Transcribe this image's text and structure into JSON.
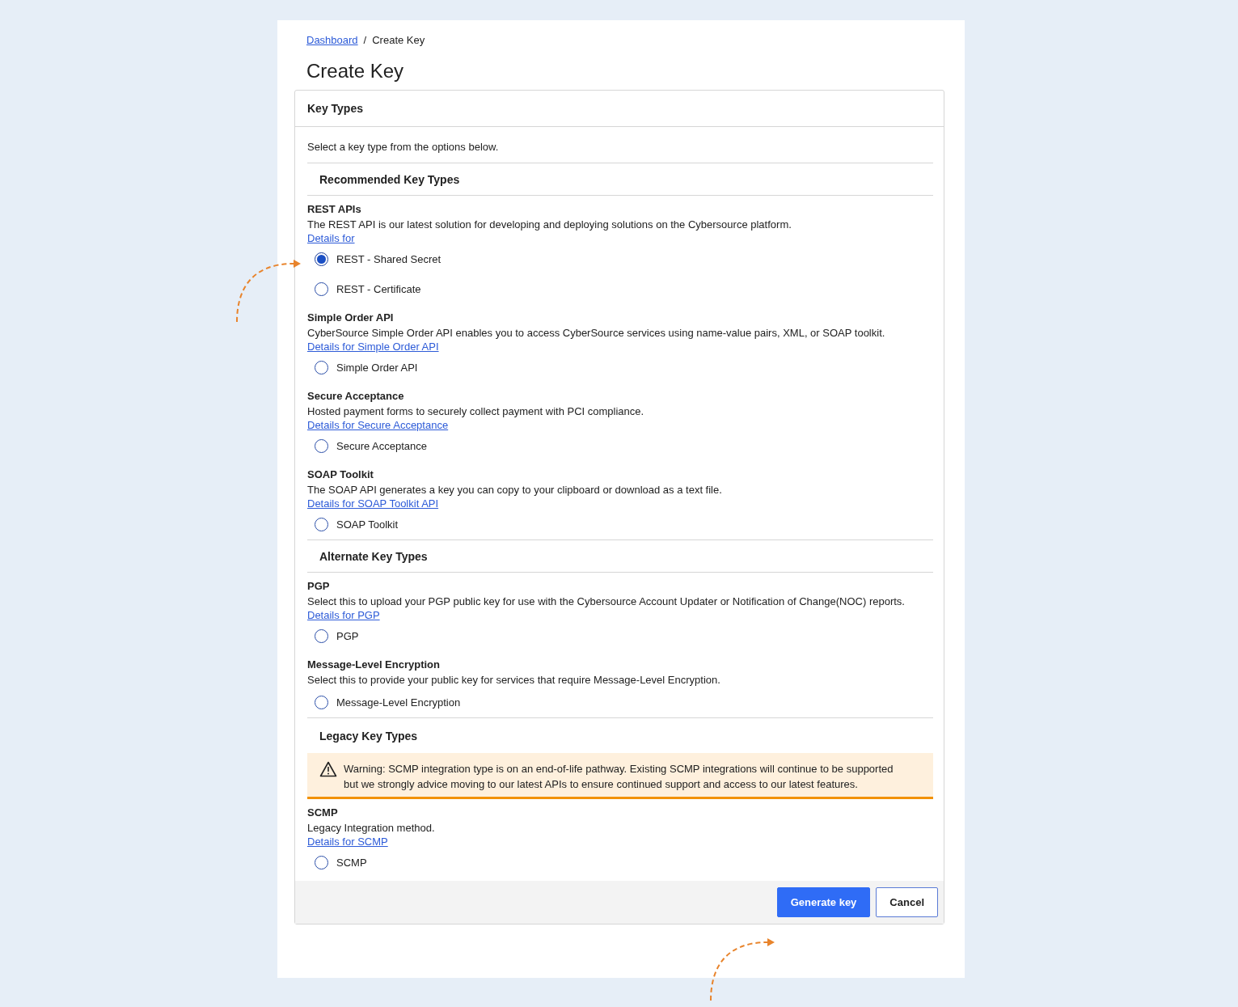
{
  "breadcrumb": {
    "link": "Dashboard",
    "separator": "/",
    "current": "Create Key"
  },
  "title": "Create Key",
  "card": {
    "header": "Key Types",
    "intro": "Select a key type from the options below.",
    "sections": [
      {
        "heading": "Recommended Key Types",
        "groups": [
          {
            "name": "REST APIs",
            "description": "The REST API is our latest solution for developing and deploying solutions on the Cybersource platform.",
            "link": "Details for",
            "options": [
              {
                "label": "REST - Shared Secret",
                "selected": true
              },
              {
                "label": "REST - Certificate",
                "selected": false
              }
            ]
          },
          {
            "name": "Simple Order API",
            "description": "CyberSource Simple Order API enables you to access CyberSource services using name-value pairs, XML, or SOAP toolkit.",
            "link": "Details for Simple Order API",
            "options": [
              {
                "label": "Simple Order API",
                "selected": false
              }
            ]
          },
          {
            "name": "Secure Acceptance",
            "description": "Hosted payment forms to securely collect payment with PCI compliance.",
            "link": "Details for Secure Acceptance",
            "options": [
              {
                "label": "Secure Acceptance",
                "selected": false
              }
            ]
          },
          {
            "name": "SOAP Toolkit",
            "description": "The SOAP API generates a key you can copy to your clipboard or download as a text file.",
            "link": "Details for SOAP Toolkit API",
            "options": [
              {
                "label": "SOAP Toolkit",
                "selected": false
              }
            ]
          }
        ]
      },
      {
        "heading": "Alternate Key Types",
        "groups": [
          {
            "name": "PGP",
            "description": "Select this to upload your PGP public key for use with the Cybersource Account Updater or Notification of Change(NOC) reports.",
            "link": "Details for PGP",
            "options": [
              {
                "label": "PGP",
                "selected": false
              }
            ]
          },
          {
            "name": "Message-Level Encryption",
            "description": "Select this to provide your public key for services that require Message-Level Encryption.",
            "options": [
              {
                "label": "Message-Level Encryption",
                "selected": false
              }
            ]
          }
        ]
      },
      {
        "heading": "Legacy Key Types",
        "warning": "Warning: SCMP integration type is on an end-of-life pathway. Existing SCMP integrations will continue to be supported but we strongly advice moving to our latest APIs to ensure continued support and access to our latest features.",
        "groups": [
          {
            "name": "SCMP",
            "description": "Legacy Integration method.",
            "link": "Details for SCMP",
            "options": [
              {
                "label": "SCMP",
                "selected": false
              }
            ]
          }
        ]
      }
    ]
  },
  "buttons": [
    {
      "label": "Generate key",
      "kind": "primary"
    },
    {
      "label": "Cancel",
      "kind": "secondary"
    }
  ]
}
